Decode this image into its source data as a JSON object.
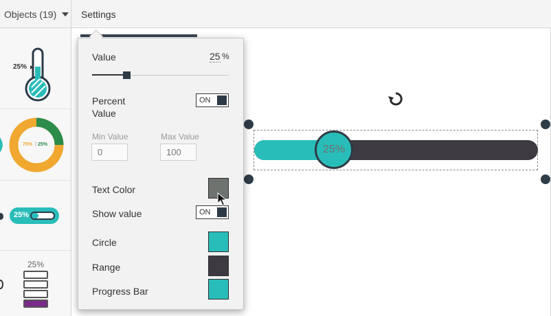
{
  "topbar": {
    "objects_tab": "Objects (19)",
    "settings_tab": "Settings"
  },
  "sidebar": {
    "thermometer_label": "25%",
    "donut_label_a": "75%",
    "donut_label_sep": "|",
    "donut_label_b": "25%",
    "pill_label": "25%",
    "stack_label": "25%"
  },
  "canvas": {
    "progress_value_label": "25%",
    "progress_fraction": 0.25
  },
  "settings": {
    "value_label": "Value",
    "value_number": "25",
    "value_unit": "%",
    "slider_fraction": 0.25,
    "percent_value_label_line1": "Percent",
    "percent_value_label_line2": "Value",
    "percent_toggle": "ON",
    "min_value_label": "Min Value",
    "min_value": "0",
    "max_value_label": "Max Value",
    "max_value": "100",
    "text_color_label": "Text Color",
    "show_value_label": "Show value",
    "show_value_toggle": "ON",
    "circle_label": "Circle",
    "range_label": "Range",
    "progress_bar_label": "Progress Bar"
  },
  "colors": {
    "teal": "#29bdb9",
    "dark": "#3d3b41",
    "text_color_swatch": "#6f7370",
    "circle_swatch": "#29bdb9",
    "range_swatch": "#3d3b41",
    "progress_bar_swatch": "#29bdb9",
    "donut_orange": "#f0a830",
    "donut_green": "#2c8c4a",
    "stack_purple": "#7b2a8c"
  }
}
